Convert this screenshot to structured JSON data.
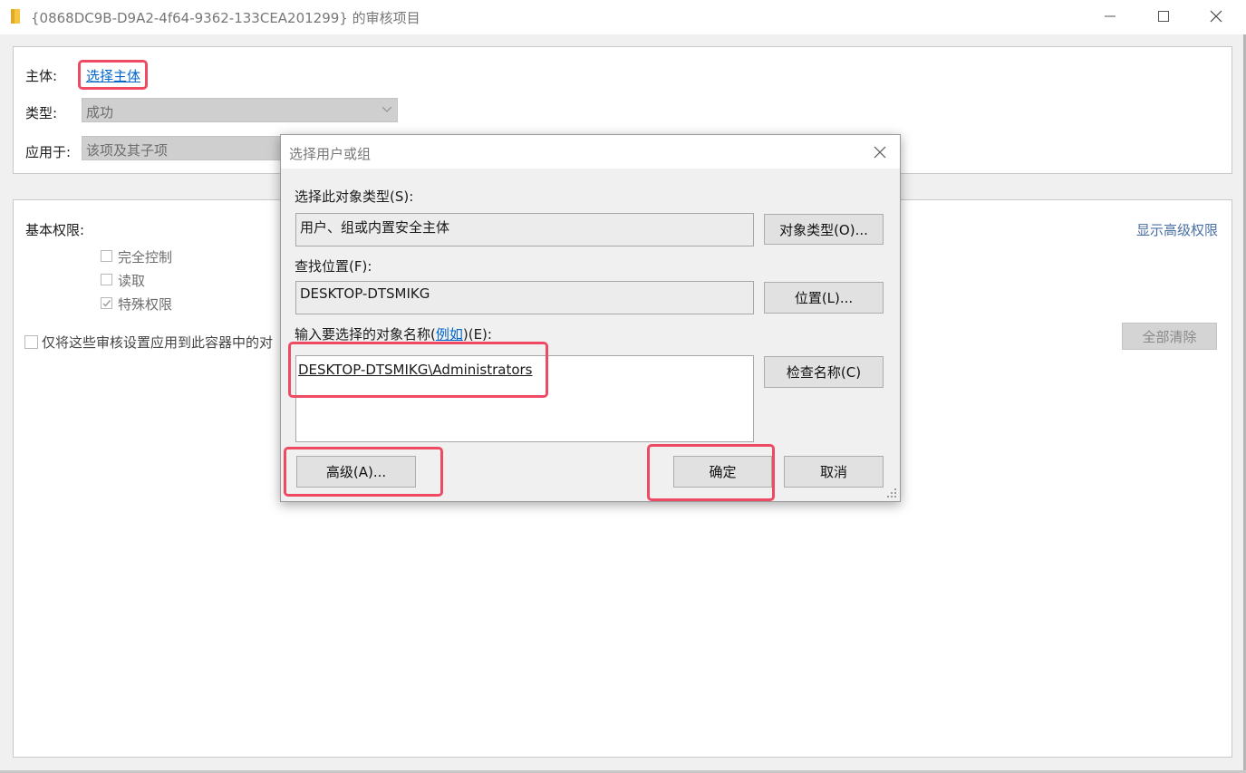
{
  "window": {
    "title": "{0868DC9B-D9A2-4f64-9362-133CEA201299} 的审核项目",
    "minimize_icon": "minimize-icon",
    "maximize_icon": "maximize-icon",
    "close_icon": "close-icon"
  },
  "principal": {
    "label": "主体:",
    "link": "选择主体"
  },
  "type": {
    "label": "类型:",
    "value": "成功"
  },
  "applies_to": {
    "label": "应用于:",
    "value": "该项及其子项"
  },
  "permissions": {
    "label": "基本权限:",
    "show_advanced": "显示高级权限",
    "items": [
      {
        "label": "完全控制",
        "checked": false
      },
      {
        "label": "读取",
        "checked": false
      },
      {
        "label": "特殊权限",
        "checked": true
      }
    ],
    "apply_only": "仅将这些审核设置应用到此容器中的对",
    "clear_all": "全部清除"
  },
  "dialog": {
    "title": "选择用户或组",
    "object_type_label": "选择此对象类型(S):",
    "object_type_value": "用户、组或内置安全主体",
    "object_types_button": "对象类型(O)...",
    "location_label": "查找位置(F):",
    "location_value": "DESKTOP-DTSMIKG",
    "location_button": "位置(L)...",
    "enter_names_label_pre": "输入要选择的对象名称(",
    "enter_names_link": "例如",
    "enter_names_label_post": ")(E):",
    "names_value": "DESKTOP-DTSMIKG\\Administrators",
    "check_names_button": "检查名称(C)",
    "advanced_button": "高级(A)...",
    "ok_button": "确定",
    "cancel_button": "取消"
  },
  "colors": {
    "highlight": "#ef4a63",
    "link": "#0066cc"
  }
}
